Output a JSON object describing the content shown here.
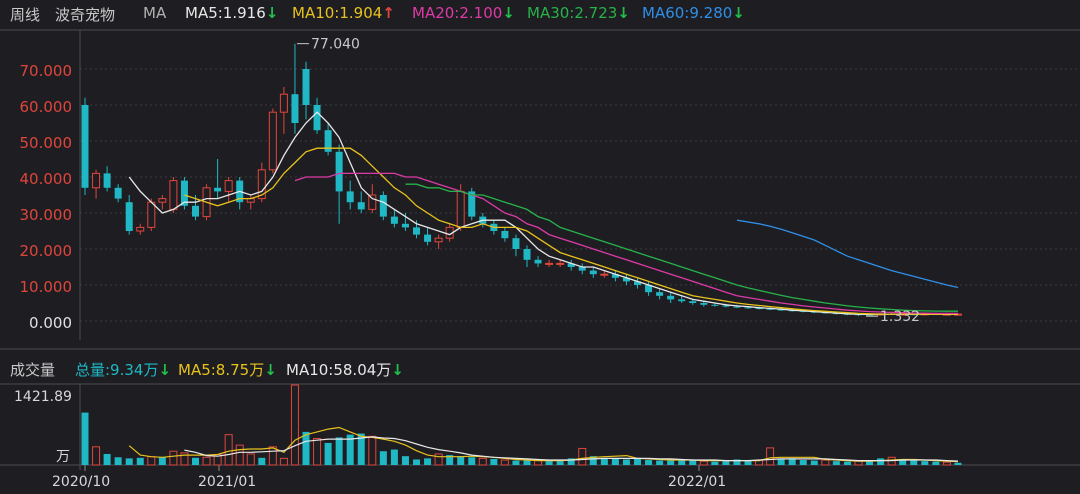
{
  "header": {
    "period": "周线",
    "name": "波奇宠物",
    "indicator": "MA",
    "ma5": "MA5:1.916",
    "ma10": "MA10:1.904",
    "ma20": "MA20:2.100",
    "ma30": "MA30:2.723",
    "ma60": "MA60:9.280",
    "arrow_down": "↓",
    "arrow_up": "↑"
  },
  "colors": {
    "up": "#e0453c",
    "down": "#1fb8c4",
    "ma5": "#e8e8e8",
    "ma10": "#e8c21c",
    "ma20": "#dd3aa6",
    "ma30": "#27b24a",
    "ma60": "#2f8fe8",
    "grid": "#3a3a40"
  },
  "volume_header": {
    "title": "成交量",
    "total": "总量:9.34万",
    "ma5": "MA5:8.75万",
    "ma10": "MA10:58.04万",
    "arrow_down": "↓"
  },
  "chart_data": {
    "type": "candlestick",
    "y_ticks": [
      "70.000",
      "60.000",
      "50.000",
      "40.000",
      "30.000",
      "20.000",
      "10.000",
      "0.000"
    ],
    "ylim": [
      0,
      77
    ],
    "annotations": {
      "high": "77.040",
      "low": "1.332"
    },
    "x_ticks": [
      "2020/10",
      "2021/01",
      "2022/01"
    ],
    "candles": [
      [
        60,
        62,
        35,
        37
      ],
      [
        37,
        42,
        34,
        41
      ],
      [
        41,
        43,
        36,
        37
      ],
      [
        37,
        38,
        33,
        34
      ],
      [
        33,
        35,
        24,
        25
      ],
      [
        25,
        27,
        24,
        26
      ],
      [
        26,
        34,
        25,
        33
      ],
      [
        33,
        35,
        31,
        34
      ],
      [
        31,
        40,
        30,
        39
      ],
      [
        39,
        40,
        31,
        32
      ],
      [
        32,
        35,
        28,
        29
      ],
      [
        29,
        38,
        28,
        37
      ],
      [
        37,
        45,
        34,
        36
      ],
      [
        36,
        40,
        33,
        39
      ],
      [
        39,
        40,
        31,
        33
      ],
      [
        33,
        35,
        31,
        34
      ],
      [
        34,
        44,
        33,
        42
      ],
      [
        42,
        59,
        41,
        58
      ],
      [
        58,
        65,
        52,
        63
      ],
      [
        63,
        77,
        52,
        55
      ],
      [
        70,
        72,
        56,
        60
      ],
      [
        60,
        62,
        52,
        53
      ],
      [
        53,
        55,
        46,
        47
      ],
      [
        47,
        49,
        27,
        36
      ],
      [
        36,
        39,
        31,
        33
      ],
      [
        33,
        36,
        30,
        31
      ],
      [
        31,
        38,
        30,
        35
      ],
      [
        35,
        36,
        28,
        29
      ],
      [
        29,
        31,
        26,
        27
      ],
      [
        27,
        30,
        25,
        26
      ],
      [
        26,
        28,
        23,
        24
      ],
      [
        24,
        26,
        21,
        22
      ],
      [
        22,
        24,
        20,
        23
      ],
      [
        23,
        27,
        22,
        26
      ],
      [
        26,
        38,
        25,
        36
      ],
      [
        36,
        37,
        28,
        29
      ],
      [
        29,
        30,
        26,
        27
      ],
      [
        27,
        28,
        24,
        25
      ],
      [
        25,
        26,
        22,
        23
      ],
      [
        23,
        24,
        18,
        20
      ],
      [
        20,
        21,
        15,
        17
      ],
      [
        17,
        18,
        15,
        16
      ],
      [
        16,
        17,
        15,
        16
      ],
      [
        16,
        17,
        15,
        16
      ],
      [
        16,
        17,
        14,
        15
      ],
      [
        15,
        16,
        13,
        14
      ],
      [
        14,
        15,
        12,
        13
      ],
      [
        13,
        14,
        12,
        13
      ],
      [
        13,
        14,
        11,
        12
      ],
      [
        12,
        13,
        10,
        11
      ],
      [
        11,
        12,
        9,
        10
      ],
      [
        10,
        11,
        7,
        8
      ],
      [
        8,
        9,
        6,
        7
      ],
      [
        7,
        8,
        5,
        6
      ],
      [
        6,
        7,
        5,
        5.5
      ],
      [
        5.5,
        6,
        4.5,
        5
      ],
      [
        5,
        5.5,
        4,
        4.5
      ],
      [
        4.5,
        5,
        4,
        4.3
      ],
      [
        4.3,
        4.8,
        3.8,
        4.0
      ],
      [
        4.0,
        4.5,
        3.6,
        3.8
      ],
      [
        3.8,
        4.2,
        3.4,
        3.6
      ],
      [
        3.6,
        4.0,
        3.2,
        3.4
      ],
      [
        3.4,
        3.8,
        3.0,
        3.2
      ],
      [
        3.2,
        3.6,
        2.8,
        3.0
      ],
      [
        3.0,
        3.3,
        2.6,
        2.8
      ],
      [
        2.8,
        3.1,
        2.4,
        2.6
      ],
      [
        2.6,
        2.9,
        2.2,
        2.4
      ],
      [
        2.4,
        2.7,
        2.0,
        2.2
      ],
      [
        2.2,
        2.5,
        1.8,
        2.0
      ],
      [
        2.0,
        2.3,
        1.6,
        1.9
      ],
      [
        1.9,
        2.2,
        1.4,
        1.8
      ],
      [
        1.8,
        2.0,
        1.3,
        1.7
      ],
      [
        1.7,
        2.2,
        1.6,
        2.0
      ],
      [
        2.0,
        2.3,
        1.7,
        1.9
      ],
      [
        1.9,
        2.1,
        1.6,
        1.9
      ],
      [
        1.9,
        2.0,
        1.6,
        1.7
      ],
      [
        1.7,
        2.3,
        1.6,
        2.1
      ],
      [
        2.1,
        2.3,
        1.7,
        1.8
      ],
      [
        1.8,
        2.0,
        1.6,
        1.9
      ],
      [
        1.9,
        2.1,
        1.7,
        1.9
      ]
    ],
    "ma": {
      "MA5": [
        null,
        null,
        null,
        null,
        40,
        36,
        33,
        30,
        31,
        33,
        33,
        34,
        34,
        35,
        36,
        35,
        36,
        40,
        46,
        51,
        55,
        58,
        55,
        51,
        44,
        37,
        34,
        33,
        31,
        29,
        27,
        26,
        25,
        24,
        26,
        27,
        28,
        28,
        28,
        26,
        23,
        20,
        18,
        17,
        16,
        15,
        15,
        14,
        13,
        12,
        11,
        10,
        9,
        8,
        7,
        6,
        5.5,
        5,
        4.5,
        4.2,
        4.0,
        3.7,
        3.5,
        3.3,
        3.0,
        2.8,
        2.6,
        2.4,
        2.2,
        2.0,
        1.9,
        1.8,
        1.8,
        1.9,
        1.9,
        1.9,
        1.9,
        1.9,
        1.9,
        1.9
      ],
      "MA10": [
        null,
        null,
        null,
        null,
        null,
        null,
        null,
        null,
        null,
        35,
        34,
        33,
        32,
        33,
        34,
        34,
        35,
        37,
        41,
        44,
        47,
        48,
        48,
        48,
        48,
        46,
        43,
        40,
        37,
        35,
        32,
        30,
        28,
        27,
        26,
        26,
        27,
        26,
        26,
        26,
        25,
        23,
        21,
        19,
        18,
        17,
        16,
        15,
        14,
        13,
        12,
        11,
        10,
        9,
        8,
        7,
        6.5,
        6,
        5.5,
        5,
        4.6,
        4.3,
        4.0,
        3.7,
        3.4,
        3.1,
        2.9,
        2.7,
        2.5,
        2.3,
        2.1,
        2.0,
        1.9,
        1.9,
        1.9,
        1.9,
        1.9,
        1.9,
        1.9,
        1.9
      ],
      "MA20": [
        null,
        null,
        null,
        null,
        null,
        null,
        null,
        null,
        null,
        null,
        null,
        null,
        null,
        null,
        null,
        null,
        null,
        null,
        null,
        39,
        40,
        40,
        40,
        41,
        41,
        41,
        41,
        41,
        41,
        40,
        40,
        39,
        38,
        37,
        36,
        35,
        34,
        32,
        30,
        29,
        27,
        26,
        24,
        23,
        22,
        21,
        20,
        19,
        18,
        17,
        16,
        15,
        14,
        13,
        12,
        11,
        10,
        9,
        8,
        7,
        6.5,
        6,
        5.5,
        5,
        4.6,
        4.2,
        3.9,
        3.6,
        3.3,
        3.0,
        2.8,
        2.6,
        2.5,
        2.4,
        2.3,
        2.2,
        2.2,
        2.1,
        2.1,
        2.1
      ],
      "MA30": [
        null,
        null,
        null,
        null,
        null,
        null,
        null,
        null,
        null,
        null,
        null,
        null,
        null,
        null,
        null,
        null,
        null,
        null,
        null,
        null,
        null,
        null,
        null,
        null,
        null,
        null,
        null,
        null,
        null,
        38,
        38,
        37,
        37,
        36,
        36,
        35,
        35,
        34,
        33,
        32,
        31,
        29,
        28,
        26,
        25,
        24,
        23,
        22,
        21,
        20,
        19,
        18,
        17,
        16,
        15,
        14,
        13,
        12,
        11,
        10,
        9.2,
        8.5,
        7.8,
        7.1,
        6.5,
        6.0,
        5.5,
        5.0,
        4.6,
        4.2,
        3.9,
        3.6,
        3.4,
        3.2,
        3.0,
        2.9,
        2.8,
        2.75,
        2.72,
        2.72
      ],
      "MA60": [
        null,
        null,
        null,
        null,
        null,
        null,
        null,
        null,
        null,
        null,
        null,
        null,
        null,
        null,
        null,
        null,
        null,
        null,
        null,
        null,
        null,
        null,
        null,
        null,
        null,
        null,
        null,
        null,
        null,
        null,
        null,
        null,
        null,
        null,
        null,
        null,
        null,
        null,
        null,
        null,
        null,
        null,
        null,
        null,
        null,
        null,
        null,
        null,
        null,
        null,
        null,
        null,
        null,
        null,
        null,
        null,
        null,
        null,
        null,
        28,
        27.5,
        27,
        26.3,
        25.5,
        24.5,
        23.5,
        22.5,
        21,
        19.5,
        18,
        17,
        16,
        15,
        14,
        13.2,
        12.4,
        11.6,
        10.8,
        10.0,
        9.3
      ]
    },
    "volume": [
      [
        95,
        0
      ],
      [
        33,
        1
      ],
      [
        20,
        0
      ],
      [
        14,
        0
      ],
      [
        12,
        0
      ],
      [
        13,
        0
      ],
      [
        15,
        1
      ],
      [
        14,
        0
      ],
      [
        25,
        1
      ],
      [
        22,
        1
      ],
      [
        13,
        0
      ],
      [
        14,
        1
      ],
      [
        19,
        1
      ],
      [
        55,
        1
      ],
      [
        36,
        1
      ],
      [
        20,
        1
      ],
      [
        13,
        0
      ],
      [
        33,
        1
      ],
      [
        12,
        1
      ],
      [
        145,
        1
      ],
      [
        60,
        0
      ],
      [
        48,
        1
      ],
      [
        40,
        0
      ],
      [
        50,
        0
      ],
      [
        55,
        0
      ],
      [
        57,
        0
      ],
      [
        52,
        1
      ],
      [
        25,
        0
      ],
      [
        28,
        0
      ],
      [
        16,
        0
      ],
      [
        10,
        0
      ],
      [
        12,
        0
      ],
      [
        20,
        1
      ],
      [
        18,
        0
      ],
      [
        16,
        0
      ],
      [
        14,
        0
      ],
      [
        12,
        1
      ],
      [
        11,
        0
      ],
      [
        9,
        1
      ],
      [
        8,
        0
      ],
      [
        8,
        0
      ],
      [
        8,
        1
      ],
      [
        7,
        0
      ],
      [
        7,
        0
      ],
      [
        12,
        0
      ],
      [
        30,
        1
      ],
      [
        16,
        0
      ],
      [
        12,
        0
      ],
      [
        11,
        0
      ],
      [
        10,
        0
      ],
      [
        12,
        0
      ],
      [
        9,
        0
      ],
      [
        8,
        0
      ],
      [
        8,
        0
      ],
      [
        10,
        0
      ],
      [
        9,
        0
      ],
      [
        7,
        1
      ],
      [
        6,
        0
      ],
      [
        7,
        0
      ],
      [
        10,
        0
      ],
      [
        9,
        0
      ],
      [
        8,
        1
      ],
      [
        31,
        1
      ],
      [
        10,
        0
      ],
      [
        12,
        0
      ],
      [
        9,
        0
      ],
      [
        8,
        0
      ],
      [
        9,
        1
      ],
      [
        7,
        0
      ],
      [
        6,
        0
      ],
      [
        7,
        1
      ],
      [
        8,
        0
      ],
      [
        12,
        0
      ],
      [
        14,
        1
      ],
      [
        10,
        0
      ],
      [
        8,
        0
      ],
      [
        7,
        0
      ],
      [
        6,
        0
      ],
      [
        5,
        1
      ],
      [
        4,
        0
      ]
    ],
    "volume_ma": {
      "MA5": [
        null,
        null,
        null,
        null,
        35,
        18,
        15,
        14,
        16,
        18,
        18,
        18,
        19,
        25,
        28,
        29,
        29,
        31,
        23,
        45,
        55,
        60,
        65,
        68,
        60,
        52,
        50,
        47,
        43,
        36,
        26,
        18,
        15,
        15,
        15,
        16,
        15,
        14,
        12,
        10,
        9,
        8,
        8,
        8,
        9,
        12,
        14,
        15,
        16,
        17,
        12,
        11,
        10,
        9,
        9,
        9,
        8,
        8,
        8,
        8,
        8,
        8,
        13,
        14,
        14,
        14,
        14,
        10,
        9,
        8,
        7,
        7,
        8,
        9,
        10,
        10,
        9,
        8,
        7,
        6
      ],
      "MA10": [
        null,
        null,
        null,
        null,
        null,
        null,
        null,
        null,
        null,
        27,
        23,
        17,
        16,
        19,
        23,
        23,
        24,
        25,
        26,
        35,
        43,
        45,
        47,
        47,
        47,
        49,
        51,
        49,
        48,
        44,
        38,
        32,
        28,
        25,
        22,
        18,
        16,
        14,
        13,
        12,
        11,
        10,
        9,
        9,
        9,
        10,
        11,
        12,
        12,
        12,
        12,
        12,
        11,
        11,
        10,
        9,
        9,
        9,
        8,
        8,
        8,
        9,
        10,
        11,
        11,
        11,
        11,
        11,
        10,
        9,
        8,
        8,
        8,
        8,
        9,
        9,
        9,
        9,
        8,
        7
      ]
    }
  }
}
